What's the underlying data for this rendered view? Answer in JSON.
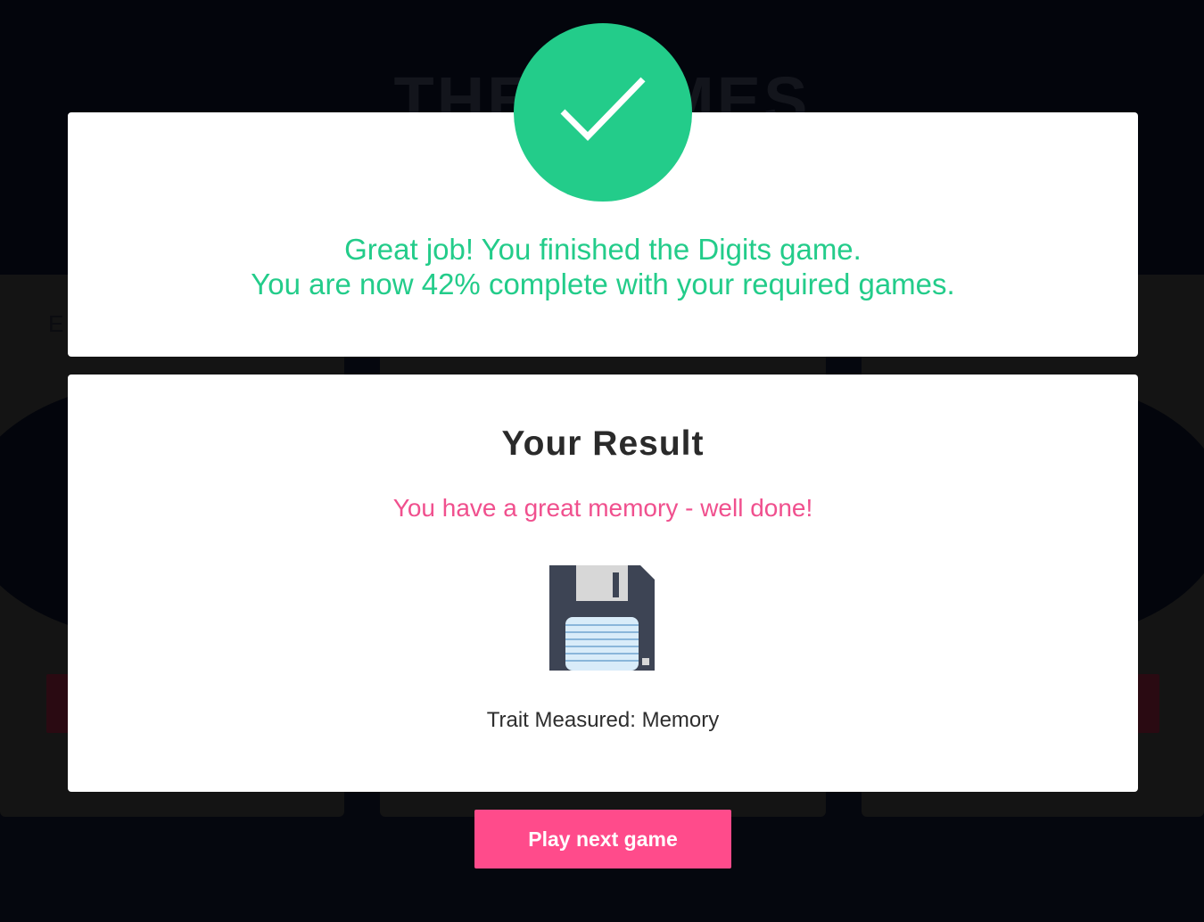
{
  "background": {
    "page_heading": "THE GAMES",
    "card_label_partial": "E"
  },
  "success": {
    "line1": "Great job! You finished the Digits game.",
    "line2": "You are now 42% complete with your required games.",
    "completion_percent": 42,
    "accent_color": "#23cc8a",
    "icon": "checkmark-icon"
  },
  "result": {
    "title": "Your Result",
    "message": "You have a great memory - well done!",
    "message_color": "#f0508e",
    "icon": "floppy-disk-icon",
    "trait_line": "Trait Measured: Memory"
  },
  "actions": {
    "next_label": "Play next game",
    "button_color": "#ff4b8b"
  }
}
